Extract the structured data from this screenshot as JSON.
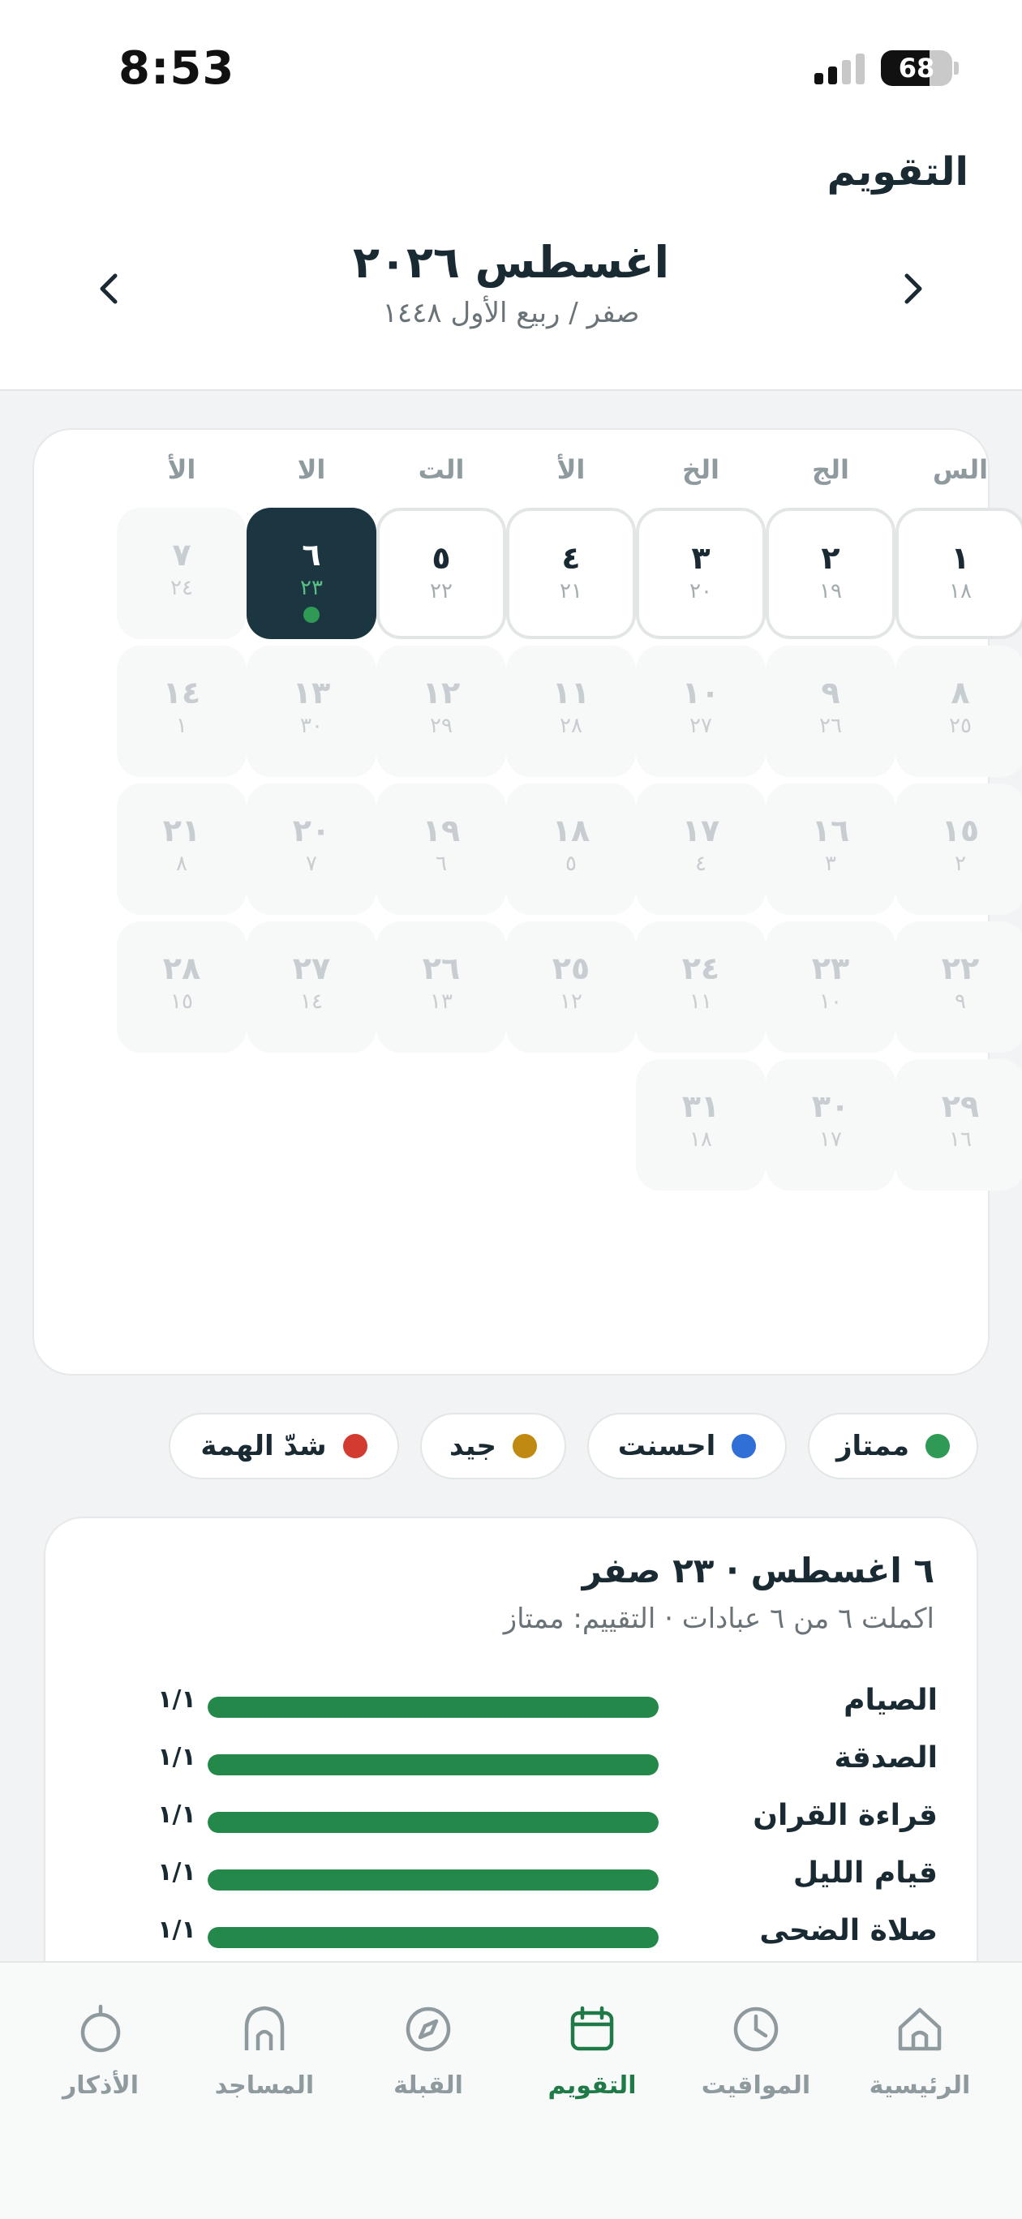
{
  "status_bar": {
    "time": "8:53",
    "battery": "68",
    "battery_level": 0.68
  },
  "header": {
    "page_title": "التقويم",
    "month_title": "اغسطس ٢٠٢٦",
    "hijri_subtitle": "صفر / ربيع الأول ١٤٤٨",
    "prev_icon": "chevron-left-icon",
    "next_icon": "chevron-right-icon"
  },
  "calendar": {
    "weekdays": [
      "السب",
      "الجم",
      "الخم",
      "الأرب",
      "الثل",
      "الاث",
      "الأح"
    ],
    "weekdays_shown": [
      "الس",
      "الج",
      "الخ",
      "الأ",
      "الت",
      "الا",
      "الأ"
    ],
    "days": [
      {
        "g": "١",
        "h": "١٨",
        "state": "past"
      },
      {
        "g": "٢",
        "h": "١٩",
        "state": "past"
      },
      {
        "g": "٣",
        "h": "٢٠",
        "state": "past"
      },
      {
        "g": "٤",
        "h": "٢١",
        "state": "past"
      },
      {
        "g": "٥",
        "h": "٢٢",
        "state": "past"
      },
      {
        "g": "٦",
        "h": "٢٣",
        "state": "today",
        "dot": "#2e9a55"
      },
      {
        "g": "٧",
        "h": "٢٤",
        "state": "future"
      },
      {
        "g": "٨",
        "h": "٢٥",
        "state": "future"
      },
      {
        "g": "٩",
        "h": "٢٦",
        "state": "future"
      },
      {
        "g": "١٠",
        "h": "٢٧",
        "state": "future"
      },
      {
        "g": "١١",
        "h": "٢٨",
        "state": "future"
      },
      {
        "g": "١٢",
        "h": "٢٩",
        "state": "future"
      },
      {
        "g": "١٣",
        "h": "٣٠",
        "state": "future"
      },
      {
        "g": "١٤",
        "h": "١",
        "state": "future"
      },
      {
        "g": "١٥",
        "h": "٢",
        "state": "future"
      },
      {
        "g": "١٦",
        "h": "٣",
        "state": "future"
      },
      {
        "g": "١٧",
        "h": "٤",
        "state": "future"
      },
      {
        "g": "١٨",
        "h": "٥",
        "state": "future"
      },
      {
        "g": "١٩",
        "h": "٦",
        "state": "future"
      },
      {
        "g": "٢٠",
        "h": "٧",
        "state": "future"
      },
      {
        "g": "٢١",
        "h": "٨",
        "state": "future"
      },
      {
        "g": "٢٢",
        "h": "٩",
        "state": "future"
      },
      {
        "g": "٢٣",
        "h": "١٠",
        "state": "future"
      },
      {
        "g": "٢٤",
        "h": "١١",
        "state": "future"
      },
      {
        "g": "٢٥",
        "h": "١٢",
        "state": "future"
      },
      {
        "g": "٢٦",
        "h": "١٣",
        "state": "future"
      },
      {
        "g": "٢٧",
        "h": "١٤",
        "state": "future"
      },
      {
        "g": "٢٨",
        "h": "١٥",
        "state": "future"
      },
      {
        "g": "٢٩",
        "h": "١٦",
        "state": "future"
      },
      {
        "g": "٣٠",
        "h": "١٧",
        "state": "future"
      },
      {
        "g": "٣١",
        "h": "١٨",
        "state": "future"
      }
    ]
  },
  "legend": [
    {
      "label": "ممتاز",
      "color": "#2e9a55"
    },
    {
      "label": "احسنت",
      "color": "#2f6fd6"
    },
    {
      "label": "جيد",
      "color": "#c08a12"
    },
    {
      "label": "شدّ الهمة",
      "color": "#d23b2f"
    }
  ],
  "detail": {
    "title": "٦ اغسطس · ٢٣ صفر",
    "subtitle": "اكملت ٦ من ٦ عبادات · التقييم: ممتاز",
    "items": [
      {
        "label": "الصيام",
        "value": "١/١",
        "progress": 1.0
      },
      {
        "label": "الصدقة",
        "value": "١/١",
        "progress": 1.0
      },
      {
        "label": "قراءة القران",
        "value": "١/١",
        "progress": 1.0
      },
      {
        "label": "قيام الليل",
        "value": "١/١",
        "progress": 1.0
      },
      {
        "label": "صلاة الضحى",
        "value": "١/١",
        "progress": 1.0
      }
    ]
  },
  "tabbar": {
    "items": [
      {
        "label": "الرئيسية",
        "icon": "home-icon",
        "active": false
      },
      {
        "label": "المواقيت",
        "icon": "clock-icon",
        "active": false
      },
      {
        "label": "التقويم",
        "icon": "calendar-icon",
        "active": true
      },
      {
        "label": "القبلة",
        "icon": "compass-icon",
        "active": false
      },
      {
        "label": "المساجد",
        "icon": "mosque-icon",
        "active": false
      },
      {
        "label": "الأذكار",
        "icon": "tasbih-icon",
        "active": false
      }
    ]
  }
}
